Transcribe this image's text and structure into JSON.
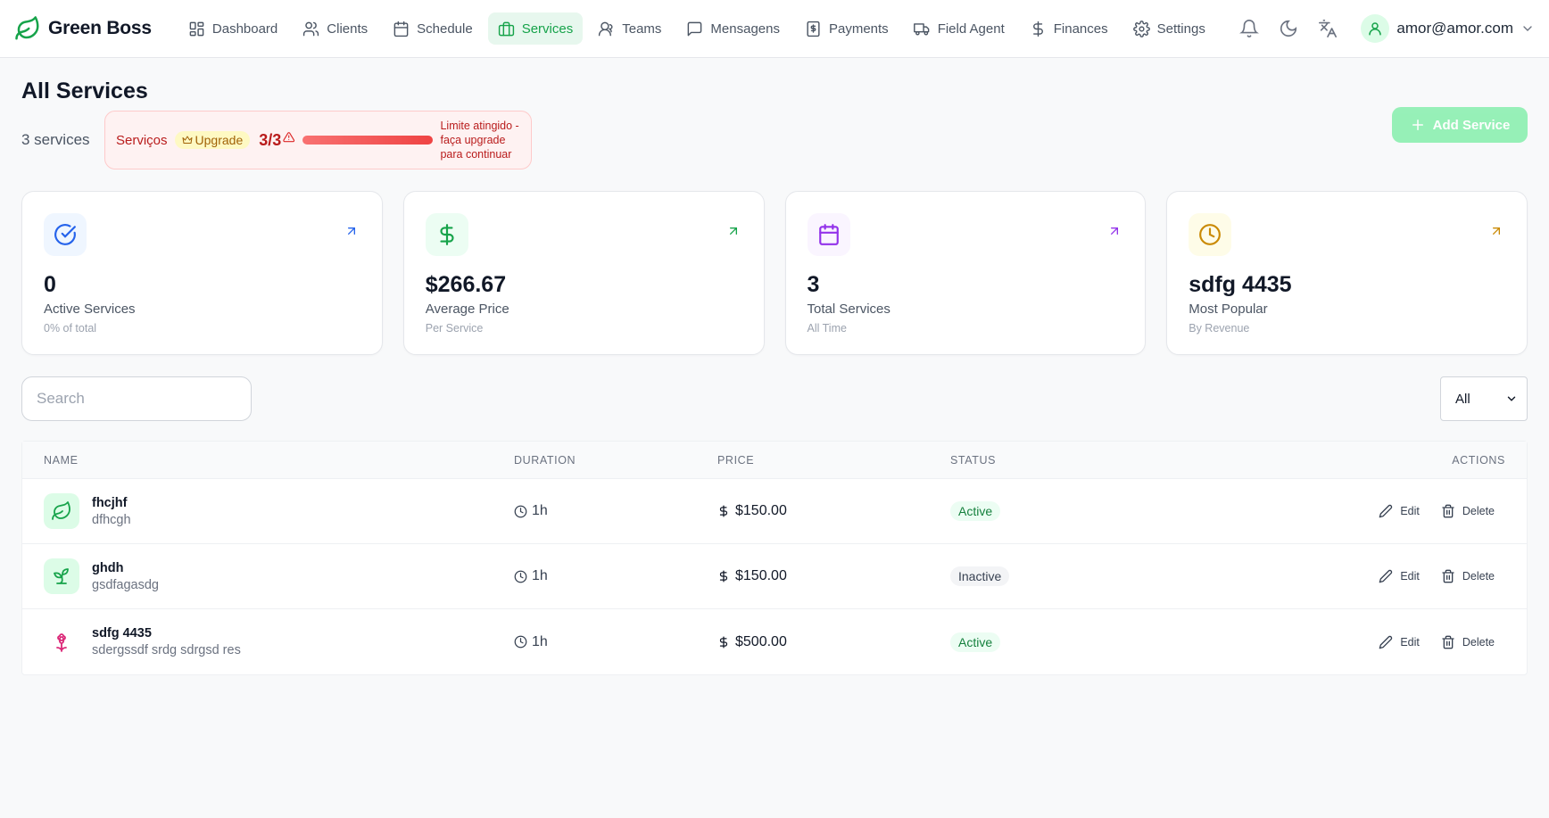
{
  "brand": {
    "name": "Green Boss",
    "icon": "leaf-icon"
  },
  "nav": {
    "items": [
      {
        "label": "Dashboard",
        "icon": "dashboard-icon",
        "active": false
      },
      {
        "label": "Clients",
        "icon": "users-icon",
        "active": false
      },
      {
        "label": "Schedule",
        "icon": "calendar-icon",
        "active": false
      },
      {
        "label": "Services",
        "icon": "briefcase-icon",
        "active": true
      },
      {
        "label": "Teams",
        "icon": "team-icon",
        "active": false
      },
      {
        "label": "Mensagens",
        "icon": "message-icon",
        "active": false
      },
      {
        "label": "Payments",
        "icon": "receipt-icon",
        "active": false
      },
      {
        "label": "Field Agent",
        "icon": "truck-icon",
        "active": false
      },
      {
        "label": "Finances",
        "icon": "dollar-icon",
        "active": false
      },
      {
        "label": "Settings",
        "icon": "gear-icon",
        "active": false
      }
    ],
    "user_email": "amor@amor.com"
  },
  "header": {
    "title": "All Services",
    "count_text": "3 services",
    "limit": {
      "label": "Serviços",
      "upgrade_label": "Upgrade",
      "count": "3/3",
      "progress_fraction": 1.0,
      "message": "Limite atingido - faça upgrade para continuar"
    },
    "add_button_label": "Add Service"
  },
  "cards": [
    {
      "value": "0",
      "label": "Active Services",
      "sub": "0% of total",
      "icon": "check-circle-icon",
      "color": "#2563eb",
      "bg": "#eff6ff"
    },
    {
      "value": "$266.67",
      "label": "Average Price",
      "sub": "Per Service",
      "icon": "dollar-icon",
      "color": "#16a34a",
      "bg": "#ecfdf3"
    },
    {
      "value": "3",
      "label": "Total Services",
      "sub": "All Time",
      "icon": "calendar-icon",
      "color": "#9333ea",
      "bg": "#faf5ff"
    },
    {
      "value": "sdfg 4435",
      "label": "Most Popular",
      "sub": "By Revenue",
      "icon": "clock-icon",
      "color": "#ca8a04",
      "bg": "#fefce8"
    }
  ],
  "search": {
    "placeholder": "Search",
    "value": ""
  },
  "filter": {
    "selected": "All"
  },
  "table": {
    "headers": {
      "name": "NAME",
      "duration": "DURATION",
      "price": "PRICE",
      "status": "STATUS",
      "actions": "ACTIONS"
    },
    "edit_label": "Edit",
    "delete_label": "Delete",
    "rows": [
      {
        "name": "fhcjhf",
        "description": "dfhcgh",
        "duration": "1h",
        "price": "$150.00",
        "status": "Active",
        "icon": "leaf-icon",
        "icon_color": "#16a34a",
        "icon_bg": "#dcfce7"
      },
      {
        "name": "ghdh",
        "description": "gsdfagasdg",
        "duration": "1h",
        "price": "$150.00",
        "status": "Inactive",
        "icon": "sprout-icon",
        "icon_color": "#16a34a",
        "icon_bg": "#dcfce7"
      },
      {
        "name": "sdfg 4435",
        "description": "sdergssdf srdg sdrgsd res",
        "duration": "1h",
        "price": "$500.00",
        "status": "Active",
        "icon": "flower-icon",
        "icon_color": "#db2777",
        "icon_bg": "#ffffff"
      }
    ]
  }
}
